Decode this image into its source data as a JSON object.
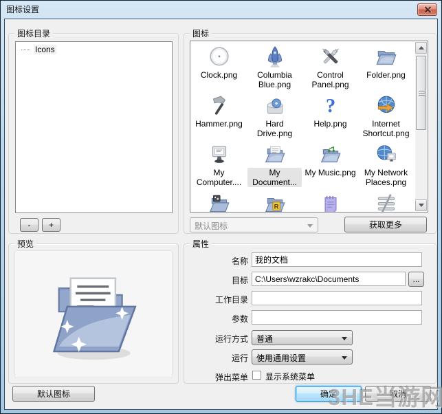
{
  "window": {
    "title": "图标设置"
  },
  "left": {
    "dir_group_label": "图标目录",
    "tree_items": [
      {
        "label": "Icons"
      }
    ],
    "minus_label": "-",
    "plus_label": "+",
    "preview_group_label": "预览",
    "preview_icon": "folder-document-large",
    "default_icon_button": "默认图标"
  },
  "icons": {
    "group_label": "图标",
    "items": [
      {
        "label": "Clock.png",
        "icon": "clock",
        "selected": false
      },
      {
        "label": "Columbia Blue.png",
        "icon": "rocket",
        "selected": false
      },
      {
        "label": "Control Panel.png",
        "icon": "tools",
        "selected": false
      },
      {
        "label": "Folder.png",
        "icon": "folder",
        "selected": false
      },
      {
        "label": "Hammer.png",
        "icon": "hammer",
        "selected": false
      },
      {
        "label": "Hard Drive.png",
        "icon": "harddrive",
        "selected": false
      },
      {
        "label": "Help.png",
        "icon": "help",
        "selected": false
      },
      {
        "label": "Internet Shortcut.png",
        "icon": "globe-arrow",
        "selected": false
      },
      {
        "label": "My Computer....",
        "icon": "computer",
        "selected": false
      },
      {
        "label": "My Document...",
        "icon": "folder-doc",
        "selected": true
      },
      {
        "label": "My Music.png",
        "icon": "folder-music",
        "selected": false
      },
      {
        "label": "My Network Places.png",
        "icon": "globe-screen",
        "selected": false
      },
      {
        "label": "",
        "icon": "folder-pictures",
        "selected": false
      },
      {
        "label": "",
        "icon": "folder-r",
        "selected": false
      },
      {
        "label": "",
        "icon": "notepad",
        "selected": false
      },
      {
        "label": "",
        "icon": "sliders",
        "selected": false
      }
    ],
    "combo_value": "默认图标",
    "combo_disabled": true,
    "get_more_button": "获取更多"
  },
  "properties": {
    "group_label": "属性",
    "fields": [
      {
        "label": "名称",
        "value": "我的文档",
        "type": "text"
      },
      {
        "label": "目标",
        "value": "C:\\Users\\wzrakc\\Documents",
        "type": "text-browse",
        "browse_label": "..."
      },
      {
        "label": "工作目录",
        "value": "",
        "type": "text"
      },
      {
        "label": "参数",
        "value": "",
        "type": "text"
      },
      {
        "label": "运行方式",
        "value": "普通",
        "type": "select"
      },
      {
        "label": "运行",
        "value": "使用通用设置",
        "type": "select"
      },
      {
        "label": "弹出菜单",
        "checkbox_label": "显示系统菜单",
        "checked": false,
        "type": "checkbox"
      }
    ]
  },
  "footer": {
    "ok": "确定",
    "cancel": "取消"
  },
  "watermark": "3HE当游网"
}
